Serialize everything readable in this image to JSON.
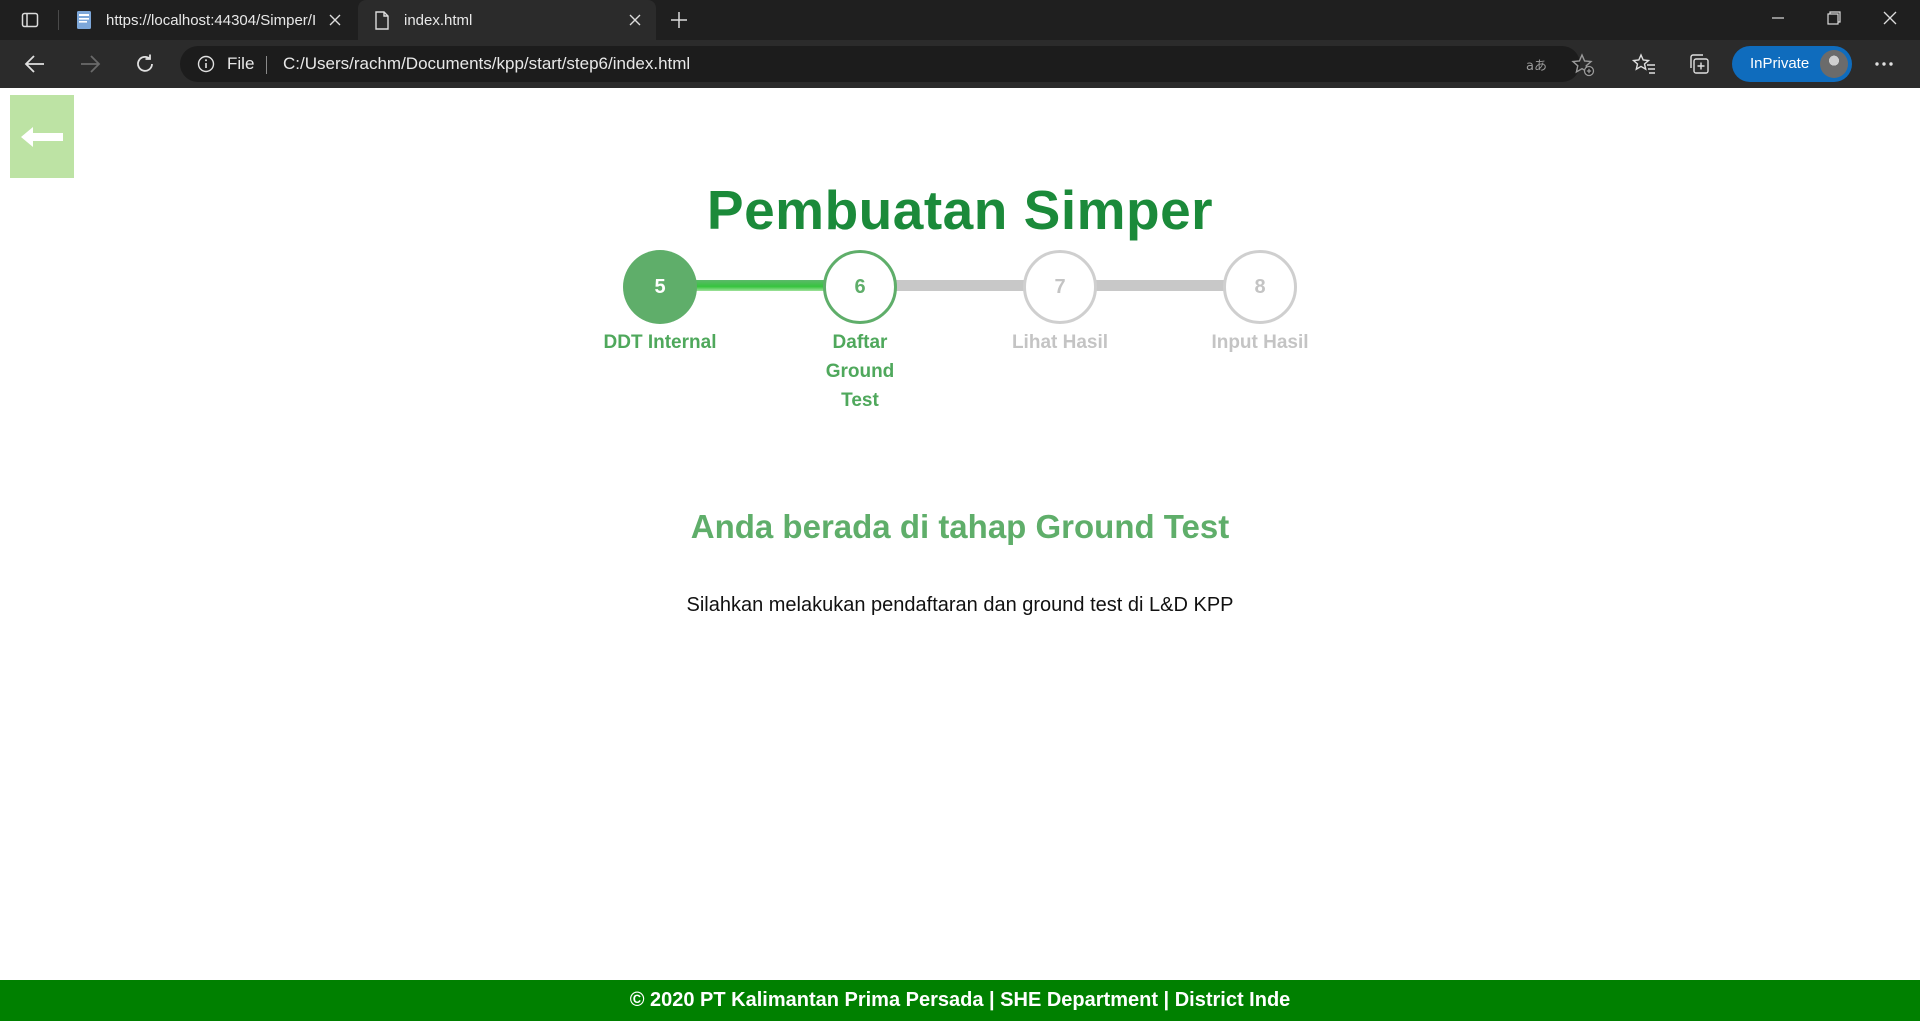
{
  "browser": {
    "tabs": [
      {
        "title": "https://localhost:44304/Simper/I",
        "icon": "page-icon",
        "active": false
      },
      {
        "title": "index.html",
        "icon": "file-icon",
        "active": true
      }
    ],
    "address": {
      "scheme_label": "File",
      "url": "C:/Users/rachm/Documents/kpp/start/step6/index.html"
    },
    "inprivate_label": "InPrivate"
  },
  "page": {
    "title": "Pembuatan Simper",
    "steps": [
      {
        "number": "5",
        "label": "DDT Internal",
        "state": "completed"
      },
      {
        "number": "6",
        "label": "Daftar Ground Test",
        "state": "current"
      },
      {
        "number": "7",
        "label": "Lihat Hasil",
        "state": "upcoming"
      },
      {
        "number": "8",
        "label": "Input Hasil",
        "state": "upcoming"
      }
    ],
    "stage_heading": "Anda berada di tahap Ground Test",
    "stage_message": "Silahkan melakukan pendaftaran dan ground test di L&D KPP",
    "footer": "© 2020 PT Kalimantan Prima Persada | SHE Department | District Inde"
  },
  "colors": {
    "primary_green": "#1b8a3a",
    "step_green": "#5fae6a",
    "inactive_gray": "#c8c8c8",
    "footer_green": "#008000",
    "back_button": "#bde3a4"
  }
}
